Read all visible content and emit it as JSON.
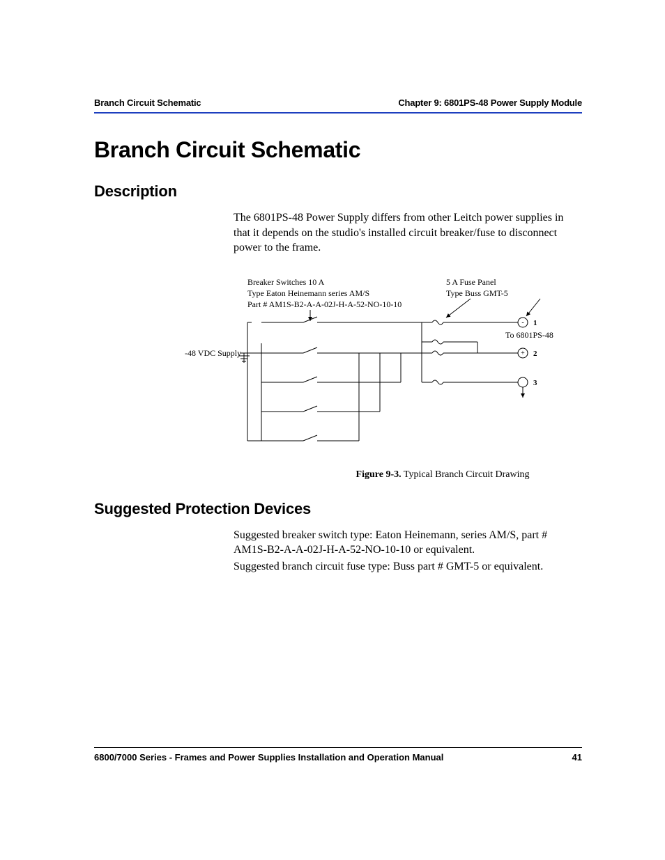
{
  "header": {
    "left": "Branch Circuit Schematic",
    "right": "Chapter 9: 6801PS-48 Power Supply Module"
  },
  "title": "Branch Circuit Schematic",
  "sections": {
    "description": {
      "heading": "Description",
      "body": "The 6801PS-48 Power Supply differs from other Leitch power supplies in that it depends on the studio's installed circuit breaker/fuse to disconnect power to the frame."
    },
    "devices": {
      "heading": "Suggested Protection Devices",
      "line1": "Suggested breaker switch type: Eaton Heinemann, series AM/S, part # AM1S-B2-A-A-02J-H-A-52-NO-10-10 or equivalent.",
      "line2": "Suggested branch circuit fuse type: Buss part # GMT-5 or equivalent."
    }
  },
  "figure": {
    "number": "Figure 9-3.",
    "caption": "Typical Branch Circuit Drawing",
    "labels": {
      "supply": "-48 VDC Supply",
      "breaker1": "Breaker Switches 10 A",
      "breaker2": "Type Eaton Heinemann series AM/S",
      "breaker3": "Part # AM1S-B2-A-A-02J-H-A-52-NO-10-10",
      "fuse1": "5 A Fuse Panel",
      "fuse2": "Type Buss GMT-5",
      "to": "To 6801PS-48",
      "t1": "1",
      "t2": "2",
      "t3": "3",
      "minus": "-",
      "plus": "+"
    }
  },
  "footer": {
    "left": "6800/7000 Series - Frames and Power Supplies Installation and Operation Manual",
    "right": "41"
  }
}
